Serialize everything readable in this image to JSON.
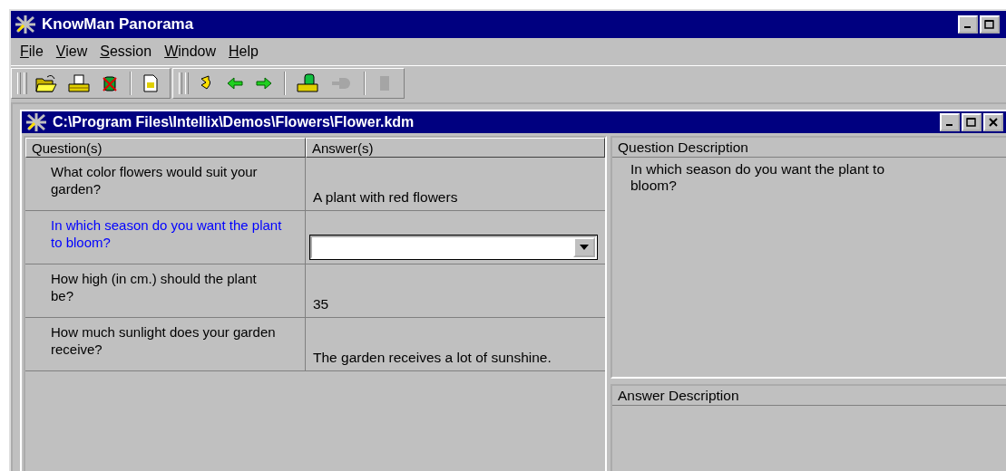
{
  "window": {
    "title": "KnowMan Panorama"
  },
  "menu": [
    {
      "label": "File"
    },
    {
      "label": "View"
    },
    {
      "label": "Session"
    },
    {
      "label": "Window"
    },
    {
      "label": "Help"
    }
  ],
  "toolbars": [
    [
      [
        {
          "kind": "open",
          "disabled": false
        },
        {
          "kind": "print",
          "disabled": false
        },
        {
          "kind": "dbdelete",
          "disabled": false
        }
      ],
      [
        {
          "kind": "doc",
          "disabled": false
        }
      ]
    ],
    [
      [
        {
          "kind": "undo",
          "disabled": false
        },
        {
          "kind": "back",
          "disabled": false
        },
        {
          "kind": "forward",
          "disabled": false
        }
      ],
      [
        {
          "kind": "dbfolder",
          "disabled": false
        },
        {
          "kind": "plug",
          "disabled": true
        }
      ],
      [
        {
          "kind": "chip",
          "disabled": true
        }
      ]
    ]
  ],
  "document": {
    "title": "C:\\Program Files\\Intellix\\Demos\\Flowers\\Flower.kdm",
    "table": {
      "columns": [
        "Question(s)",
        "Answer(s)"
      ],
      "rows": [
        {
          "question": " What color flowers would suit your garden?",
          "answer": {
            "kind": "text",
            "value": "A plant with red flowers"
          },
          "selected": false
        },
        {
          "question": "In which season do you want the plant to bloom?",
          "answer": {
            "kind": "dropdown"
          },
          "selected": true
        },
        {
          "question": "How high (in cm.) should the plant be?",
          "answer": {
            "kind": "text",
            "value": "35"
          },
          "selected": false
        },
        {
          "question": "How much sunlight does your garden receive?",
          "answer": {
            "kind": "text",
            "value": "The garden receives a lot of sunshine."
          },
          "selected": false
        }
      ]
    },
    "question_description": {
      "heading": "Question Description",
      "text": "In which season do you want the plant to bloom?"
    },
    "answer_description": {
      "heading": "Answer Description"
    }
  }
}
